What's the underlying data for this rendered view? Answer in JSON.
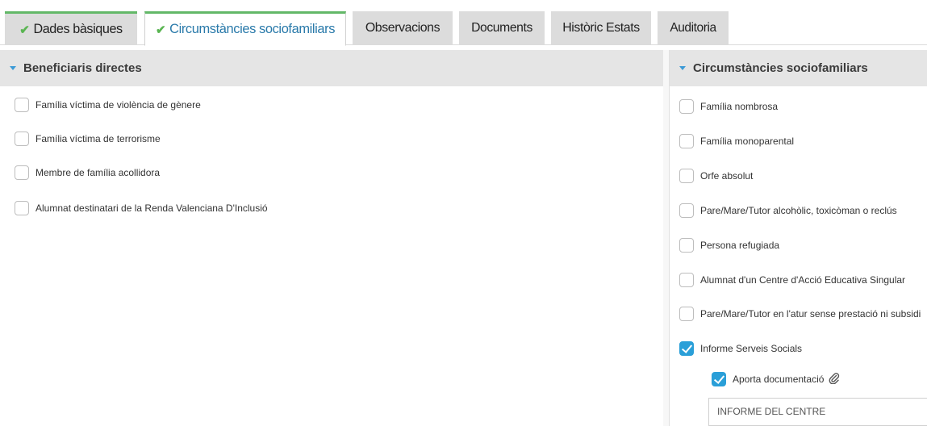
{
  "tabs": [
    {
      "label": "Dades bàsiques",
      "check": "✔"
    },
    {
      "label": "Circumstàncies sociofamiliars",
      "check": "✔"
    },
    {
      "label": "Observacions"
    },
    {
      "label": "Documents"
    },
    {
      "label": "Històric Estats"
    },
    {
      "label": "Auditoria"
    }
  ],
  "left_panel": {
    "title": "Beneficiaris directes",
    "items": [
      {
        "label": "Família víctima de violència de gènere",
        "checked": false
      },
      {
        "label": "Família víctima de terrorisme",
        "checked": false
      },
      {
        "label": "Membre de família acollidora",
        "checked": false
      },
      {
        "label": "Alumnat destinatari de la Renda Valenciana D'Inclusió",
        "checked": false
      }
    ]
  },
  "right_panel": {
    "title": "Circumstàncies sociofamiliars",
    "items": [
      {
        "label": "Família nombrosa",
        "checked": false
      },
      {
        "label": "Família monoparental",
        "checked": false
      },
      {
        "label": "Orfe absolut",
        "checked": false
      },
      {
        "label": "Pare/Mare/Tutor alcohòlic, toxicòman o reclús",
        "checked": false
      },
      {
        "label": "Persona refugiada",
        "checked": false
      },
      {
        "label": "Alumnat d'un Centre d'Acció Educativa Singular",
        "checked": false
      },
      {
        "label": "Pare/Mare/Tutor en l'atur sense prestació ni subsidi",
        "checked": false
      },
      {
        "label": "Informe Serveis Socials",
        "checked": true
      }
    ],
    "sub_item": {
      "label": "Aporta documentació",
      "checked": true,
      "icon": "paperclip-icon"
    },
    "text_field_value": "INFORME DEL CENTRE"
  },
  "colors": {
    "accent_blue": "#2a9fd8",
    "tab_green": "#63b868",
    "active_tab_text": "#2a7aaa"
  }
}
